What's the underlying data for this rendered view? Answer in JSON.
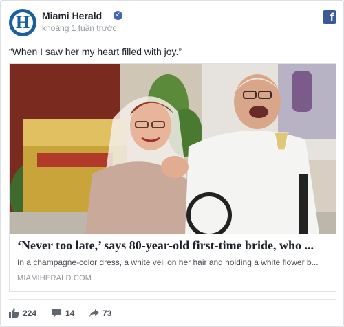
{
  "post": {
    "page_name": "Miami Herald",
    "timestamp": "khoảng 1 tuần trước",
    "text": "“When I saw her my heart filled with joy.”",
    "avatar_letter": "H",
    "verified_icon": "check-badge-icon",
    "platform_icon": "facebook-icon"
  },
  "link": {
    "title": "‘Never too late,’ says 80-year-old first-time bride, who ...",
    "description": "In a champagne-color dress, a white veil on her hair and holding a white flower b...",
    "domain": "MIAMIHERALD.COM",
    "image_alt": "Elderly bride in veil and elderly groom in wheelchair holding hands and laughing"
  },
  "stats": {
    "likes": "224",
    "comments": "14",
    "shares": "73"
  },
  "colors": {
    "brand_blue": "#1a5f9e",
    "facebook_blue": "#3b5998",
    "verified_blue": "#4267b2",
    "text_primary": "#1d2129",
    "text_secondary": "#90949c"
  }
}
